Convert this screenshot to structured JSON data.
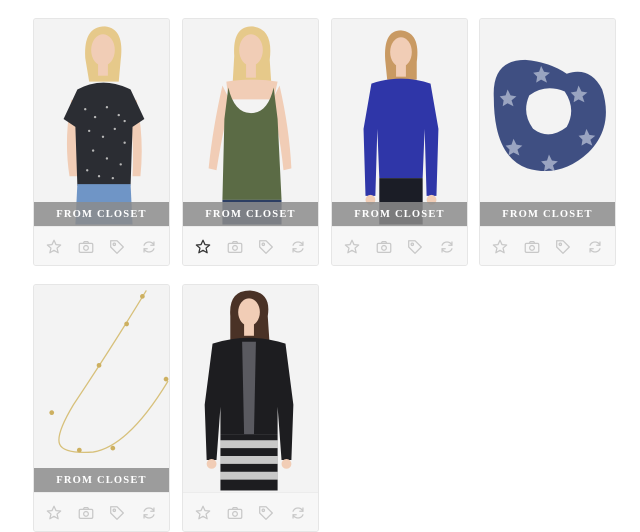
{
  "banner_label": "FROM CLOSET",
  "items": [
    {
      "product": "patterned-tee",
      "starred": false
    },
    {
      "product": "olive-tank",
      "starred": true
    },
    {
      "product": "cobalt-sweater",
      "starred": false
    },
    {
      "product": "navy-scarf",
      "starred": false
    },
    {
      "product": "gold-necklace",
      "starred": false
    },
    {
      "product": "black-cardigan",
      "starred": false
    }
  ],
  "action_icons": [
    "star-icon",
    "camera-icon",
    "tag-icon",
    "refresh-icon"
  ],
  "colors": {
    "banner": "#8c8c8c",
    "card_bg": "#f3f3f3",
    "icon_inactive": "#c8c8c8",
    "icon_active": "#333333"
  }
}
